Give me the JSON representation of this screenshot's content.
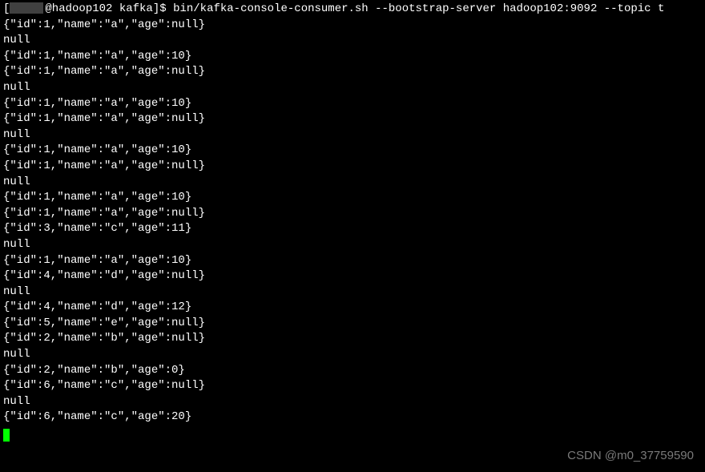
{
  "prompt": {
    "open_bracket": "[",
    "user_at": "@hadoop102",
    "path": "kafka",
    "close_bracket": "]",
    "symbol": "$"
  },
  "command": "bin/kafka-console-consumer.sh --bootstrap-server hadoop102:9092 --topic t",
  "output_lines": [
    "{\"id\":1,\"name\":\"a\",\"age\":null}",
    "null",
    "{\"id\":1,\"name\":\"a\",\"age\":10}",
    "{\"id\":1,\"name\":\"a\",\"age\":null}",
    "null",
    "{\"id\":1,\"name\":\"a\",\"age\":10}",
    "{\"id\":1,\"name\":\"a\",\"age\":null}",
    "null",
    "{\"id\":1,\"name\":\"a\",\"age\":10}",
    "{\"id\":1,\"name\":\"a\",\"age\":null}",
    "null",
    "{\"id\":1,\"name\":\"a\",\"age\":10}",
    "{\"id\":1,\"name\":\"a\",\"age\":null}",
    "{\"id\":3,\"name\":\"c\",\"age\":11}",
    "null",
    "{\"id\":1,\"name\":\"a\",\"age\":10}",
    "{\"id\":4,\"name\":\"d\",\"age\":null}",
    "null",
    "{\"id\":4,\"name\":\"d\",\"age\":12}",
    "{\"id\":5,\"name\":\"e\",\"age\":null}",
    "{\"id\":2,\"name\":\"b\",\"age\":null}",
    "null",
    "{\"id\":2,\"name\":\"b\",\"age\":0}",
    "{\"id\":6,\"name\":\"c\",\"age\":null}",
    "null",
    "{\"id\":6,\"name\":\"c\",\"age\":20}"
  ],
  "watermark": "CSDN @m0_37759590"
}
